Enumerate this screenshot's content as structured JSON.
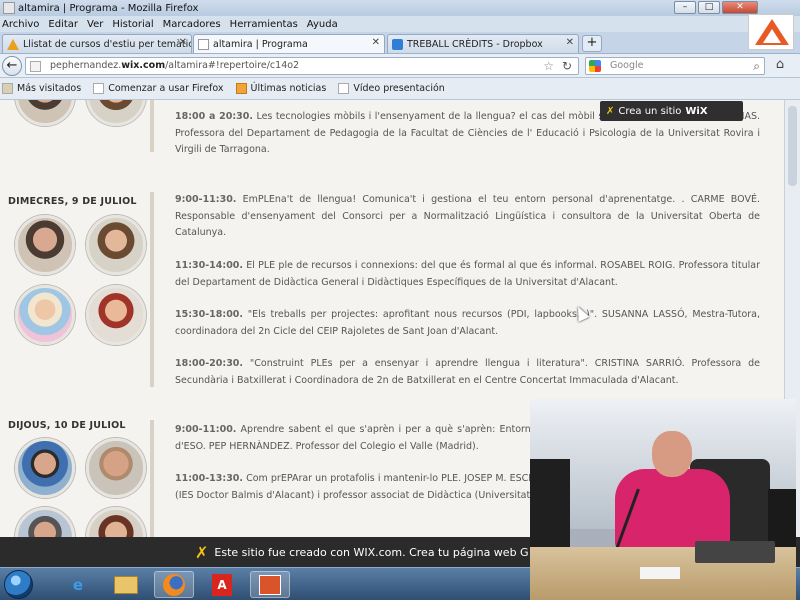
{
  "window": {
    "title": "altamira | Programa - Mozilla Firefox"
  },
  "menubar": [
    "Archivo",
    "Editar",
    "Ver",
    "Historial",
    "Marcadores",
    "Herramientas",
    "Ayuda"
  ],
  "tabs": [
    {
      "label": "Llistat de cursos d'estiu per temàtica. ...",
      "icon": "warning-icon",
      "active": false
    },
    {
      "label": "altamira | Programa",
      "icon": "page-icon",
      "active": true
    },
    {
      "label": "TREBALL CRÈDITS - Dropbox",
      "icon": "dropbox-icon",
      "active": false
    }
  ],
  "newtab_label": "+",
  "url": {
    "prefix": "pephernandez.",
    "domain": "wix.com",
    "path": "/altamira#!repertoire/c14o2"
  },
  "search": {
    "engine": "Google",
    "placeholder": "Google"
  },
  "bookmarks": [
    "Más visitados",
    "Comenzar a usar Firefox",
    "Últimas noticias",
    "Vídeo presentación"
  ],
  "wix_tooltip": {
    "text": "Crea un sitio",
    "brand": "WiX"
  },
  "schedule": {
    "days": [
      {
        "label": "DIMECRES, 9 DE JULIOL"
      },
      {
        "label": "DIJOUS, 10 DE JULIOL"
      }
    ],
    "entries": [
      {
        "time": "18:00 a 20:30.",
        "text": " Les tecnologies mòbils i l'ensenyament de la llengua? el cas del mòbil storytelling. M. ÀNGELS ENCINAS. Professora del Departament de Pedagogia de la Facultat de Ciències de l' Educació i Psicologia de la Universitat Rovira i Virgili de Tarragona."
      },
      {
        "time": "9:00-11:30.",
        "text": " EmPLEna't de llengua! Comunica't i gestiona el teu entorn personal d'aprenentatge. . CARME BOVÉ. Responsable d'ensenyament del Consorci per a Normalització Lingüística i consultora de la Universitat Oberta de Catalunya."
      },
      {
        "time": "11:30-14:00.",
        "text": " El PLE ple de recursos i connexions: del que és formal al que és informal. ROSABEL ROIG. Professora titular del Departament de Didàctica General i Didàctiques Específiques de la Universitat d'Alacant."
      },
      {
        "time": "15:30-18:00.",
        "text": " \"Els treballs per projectes: aprofitant nous recursos (PDI, lapbooks...)\". SUSANNA LASSÓ, Mestra-Tutora, coordinadora del 2n Cicle del CEIP Rajoletes de Sant Joan d'Alacant."
      },
      {
        "time": "18:00-20:30.",
        "text": " \"Construint PLEs per a ensenyar i aprendre llengua i literatura\". CRISTINA SARRIÓ. Professora de Secundària i Batxillerat i Coordinadora de 2n de Batxillerat en el Centre Concertat Immaculada d'Alacant."
      },
      {
        "time": "9:00-11:00.",
        "text": " Aprendre sabent el que s'aprèn i per a què s'aprèn: Entorn personal d'aprenentatge (PLE) en Primer Cicle d'ESO. PEP HERNÀNDEZ. Professor del Colegio el Valle (Madrid)."
      },
      {
        "time": "11:00-13:30.",
        "text": " Com prEPArar un protafolis i mantenir-lo PLE. JOSEP M. ESCLAPÉS. Professor de Valencià: llengua i literatura (IES Doctor Balmis d'Alacant) i professor associat de Didàctica (Universitat d'Alacant)."
      }
    ]
  },
  "wix_footer": {
    "text": "Este sitio fue creado con WIX.com. Crea tu página web G"
  },
  "taskbar": [
    "start-orb",
    "internet-explorer-icon",
    "file-explorer-icon",
    "firefox-icon",
    "pdf-reader-icon",
    "presentation-icon"
  ],
  "colors": {
    "accent": "#2b2b2b",
    "wix_yellow": "#f3c316",
    "shirt_pink": "#d8246a"
  }
}
